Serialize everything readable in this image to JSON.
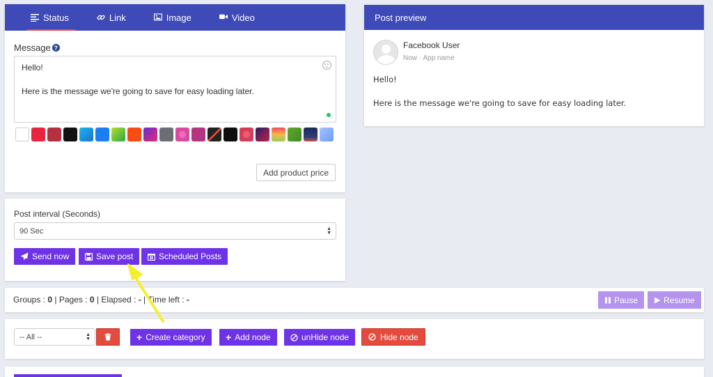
{
  "tabs": [
    {
      "label": "Status",
      "icon": "lines-icon"
    },
    {
      "label": "Link",
      "icon": "link-icon"
    },
    {
      "label": "Image",
      "icon": "image-icon"
    },
    {
      "label": "Video",
      "icon": "video-icon"
    }
  ],
  "composer": {
    "message_label": "Message",
    "message_line1": "Hello!",
    "message_line2": "Here is the message we're going to save for easy loading later.",
    "add_price_label": "Add product price"
  },
  "swatches": [
    "#ffffff",
    "#e8243e",
    "#b5313f",
    "#111111",
    "linear-gradient(135deg,#1fb5e8,#1773d1)",
    "#1a7ff3",
    "linear-gradient(135deg,#b4e02a,#2aa74a)",
    "#f94c14",
    "linear-gradient(135deg,#6b2bd1,#e32a73)",
    "#6b6e75",
    "radial-gradient(circle,#f06ab9 35%,#d94aa0 36%)",
    "#b4357f",
    "linear-gradient(135deg,#222 45%,#e24a2d 46%,#e24a2d 55%,#222 56%)",
    "#0e0e0e",
    "radial-gradient(circle,#ee5a72 35%,#d43c58 36%)",
    "linear-gradient(135deg,#2b1c62,#c0234a)",
    "linear-gradient(180deg,#f24a5a,#f8b84a,#8fd05a)",
    "linear-gradient(135deg,#64a730,#3f8a23)",
    "linear-gradient(180deg,#1b2a5a,#2d3f78 70%,#e04848)",
    "linear-gradient(135deg,#a4c3ff,#6f9cf5)"
  ],
  "interval": {
    "label": "Post interval (Seconds)",
    "selected": "90 Sec",
    "send_now": "Send now",
    "save_post": "Save post",
    "scheduled_posts": "Scheduled Posts"
  },
  "preview": {
    "header": "Post preview",
    "user": "Facebook User",
    "meta": "Now · App name",
    "line1": "Hello!",
    "line2": "Here is the message we're going to save for easy loading later."
  },
  "status": {
    "groups_label": "Groups : ",
    "groups": "0",
    "pages_label": " | Pages : ",
    "pages": "0",
    "elapsed_label": " | Elapsed : ",
    "elapsed": "-",
    "time_left_label": " | Time left : ",
    "time_left": "-",
    "pause": "Pause",
    "resume": "Resume"
  },
  "categories": {
    "selected": "-- All --",
    "create_category": "Create category",
    "add_node": "Add node",
    "unhide_node": "unHide node",
    "hide_node": "Hide node"
  },
  "colors": {
    "header_blue": "#3d4ab8",
    "button_purple": "#6e33e6",
    "button_light_purple": "#b494ef",
    "button_red": "#e24b3e",
    "arrow_yellow": "#f5ee2f"
  }
}
